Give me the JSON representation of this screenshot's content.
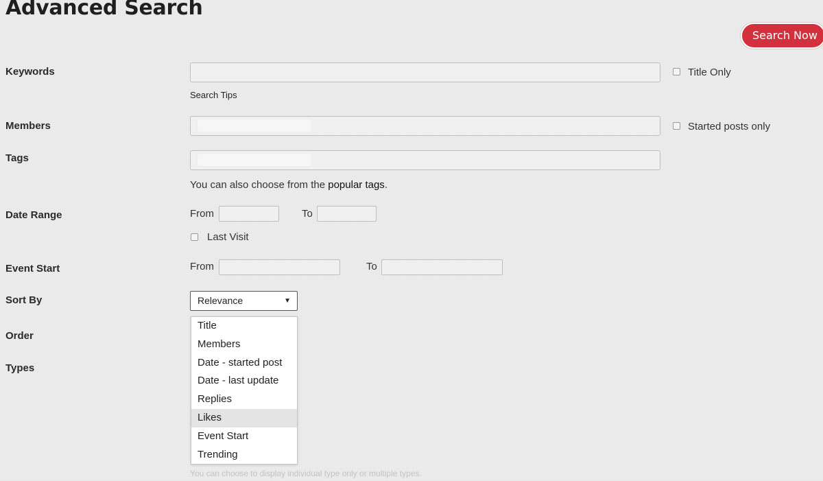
{
  "page": {
    "title": "Advanced Search"
  },
  "toolbar": {
    "search_now": "Search Now"
  },
  "keywords": {
    "label": "Keywords",
    "value": "",
    "title_only": "Title Only",
    "tips": "Search Tips"
  },
  "members": {
    "label": "Members",
    "started_only": "Started posts only"
  },
  "tags": {
    "label": "Tags",
    "help_prefix": "You can also choose from the ",
    "help_link": "popular tags",
    "help_suffix": "."
  },
  "date_range": {
    "label": "Date Range",
    "from": "From",
    "to": "To",
    "last_visit": "Last Visit"
  },
  "event_start": {
    "label": "Event Start",
    "from": "From",
    "to": "To"
  },
  "sort_by": {
    "label": "Sort By",
    "selected": "Relevance",
    "highlighted": "Likes",
    "options": [
      "Title",
      "Members",
      "Date - started post",
      "Date - last update",
      "Replies",
      "Likes",
      "Event Start",
      "Trending"
    ]
  },
  "order": {
    "label": "Order"
  },
  "types": {
    "label": "Types",
    "help": "You can choose to display individual type only or multiple types."
  },
  "colors": {
    "accent": "#d2303c",
    "background": "#ececec",
    "highlight": "#e4e4e4"
  }
}
